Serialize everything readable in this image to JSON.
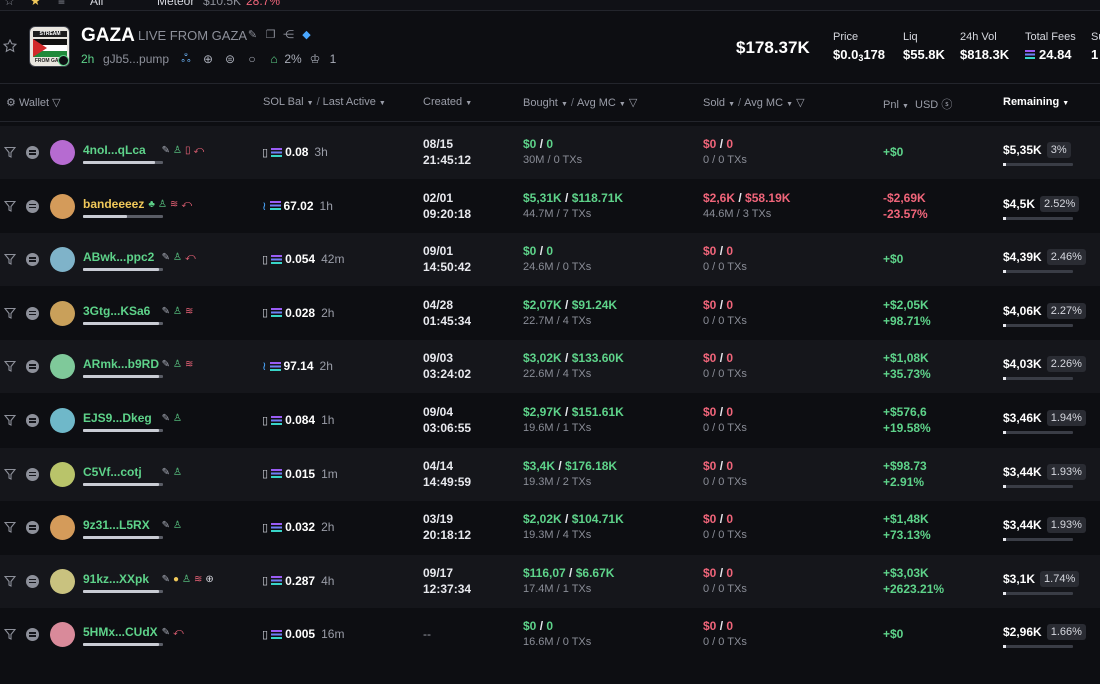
{
  "top_strip": {
    "all_label": "All",
    "ticker": "Meteor",
    "mcap": "$10.5K",
    "change": "28.7%"
  },
  "header": {
    "logo_top": "STREAM",
    "logo_bottom": "FROM GAZA",
    "ticker": "GAZA",
    "name": "LIVE FROM GAZA",
    "age": "2h",
    "address": "gJb5...pump",
    "holders_pct": "2%",
    "holders_count": "1",
    "market_cap": "$178.37K",
    "stats": [
      {
        "label": "Price",
        "value_main": "$0.0",
        "value_sub": "3",
        "value_tail": "178"
      },
      {
        "label": "Liq",
        "value": "$55.8K"
      },
      {
        "label": "24h Vol",
        "value": "$818.3K"
      },
      {
        "label": "Total Fees",
        "value": "24.84"
      },
      {
        "label": "Su",
        "value": "1"
      }
    ]
  },
  "columns": {
    "wallet": "Wallet",
    "sol_bal": "SOL Bal",
    "last_active": "Last Active",
    "created": "Created",
    "bought": "Bought",
    "avg_mc": "Avg MC",
    "sold": "Sold",
    "pnl": "Pnl",
    "usd": "USD",
    "remaining": "Remaining"
  },
  "colors": {
    "green": "#5ed38a",
    "red": "#f0657a",
    "bg": "#0d0e12",
    "row_alt": "#15161b"
  },
  "rows": [
    {
      "wallet": "4noI...qLca",
      "wallet_color": "green",
      "icons": [
        "edit-icon",
        "person-icon",
        "clipboard-icon",
        "exit-icon"
      ],
      "avatar_color": "#b66bd1",
      "invested_frac": 0.9,
      "dolphin": false,
      "sol_bal": "0.08",
      "last_active": "3h",
      "created_date": "08/15",
      "created_time": "21:45:12",
      "bought_usd": "$0",
      "bought_mc": "0",
      "bought_sub": "30M / 0 TXs",
      "sold_usd": "$0",
      "sold_mc": "0",
      "sold_sub": "0 / 0 TXs",
      "pnl1": "+$0",
      "pnl2": "",
      "pnl_color": "green",
      "remaining": "$5,35K",
      "remaining_pct": "3%"
    },
    {
      "wallet": "bandeeeez",
      "wallet_color": "yellow",
      "icons": [
        "tree-icon",
        "person-icon",
        "layers-icon",
        "exit-icon"
      ],
      "avatar_color": "#d49b5a",
      "invested_frac": 0.55,
      "dolphin": true,
      "sol_bal": "67.02",
      "last_active": "1h",
      "created_date": "02/01",
      "created_time": "09:20:18",
      "bought_usd": "$5,31K",
      "bought_mc": "$118.71K",
      "bought_sub": "44.7M / 7 TXs",
      "sold_usd": "$2,6K",
      "sold_mc": "$58.19K",
      "sold_sub": "44.6M / 3 TXs",
      "sold_red": true,
      "pnl1": "-$2,69K",
      "pnl2": "-23.57%",
      "pnl_color": "red",
      "remaining": "$4,5K",
      "remaining_pct": "2.52%"
    },
    {
      "wallet": "ABwk...ppc2",
      "wallet_color": "green",
      "icons": [
        "edit-icon",
        "person-icon",
        "exit-icon"
      ],
      "avatar_color": "#7fb3c9",
      "invested_frac": 0.95,
      "dolphin": false,
      "sol_bal": "0.054",
      "last_active": "42m",
      "created_date": "09/01",
      "created_time": "14:50:42",
      "bought_usd": "$0",
      "bought_mc": "0",
      "bought_sub": "24.6M / 0 TXs",
      "sold_usd": "$0",
      "sold_mc": "0",
      "sold_sub": "0 / 0 TXs",
      "pnl1": "+$0",
      "pnl2": "",
      "pnl_color": "green",
      "remaining": "$4,39K",
      "remaining_pct": "2.46%"
    },
    {
      "wallet": "3Gtg...KSa6",
      "wallet_color": "green",
      "icons": [
        "edit-icon",
        "person-icon",
        "layers-icon"
      ],
      "avatar_color": "#c9a05a",
      "invested_frac": 0.95,
      "dolphin": false,
      "sol_bal": "0.028",
      "last_active": "2h",
      "created_date": "04/28",
      "created_time": "01:45:34",
      "bought_usd": "$2,07K",
      "bought_mc": "$91.24K",
      "bought_sub": "22.7M / 4 TXs",
      "sold_usd": "$0",
      "sold_mc": "0",
      "sold_sub": "0 / 0 TXs",
      "pnl1": "+$2,05K",
      "pnl2": "+98.71%",
      "pnl_color": "green",
      "remaining": "$4,06K",
      "remaining_pct": "2.27%"
    },
    {
      "wallet": "ARmk...b9RD",
      "wallet_color": "green",
      "icons": [
        "edit-icon",
        "person-icon",
        "layers-icon"
      ],
      "avatar_color": "#7fc99a",
      "invested_frac": 0.95,
      "dolphin": true,
      "sol_bal": "97.14",
      "last_active": "2h",
      "created_date": "09/03",
      "created_time": "03:24:02",
      "bought_usd": "$3,02K",
      "bought_mc": "$133.60K",
      "bought_sub": "22.6M / 4 TXs",
      "sold_usd": "$0",
      "sold_mc": "0",
      "sold_sub": "0 / 0 TXs",
      "pnl1": "+$1,08K",
      "pnl2": "+35.73%",
      "pnl_color": "green",
      "remaining": "$4,03K",
      "remaining_pct": "2.26%"
    },
    {
      "wallet": "EJS9...Dkeg",
      "wallet_color": "green",
      "icons": [
        "edit-icon",
        "person-icon"
      ],
      "avatar_color": "#6fb8c9",
      "invested_frac": 0.95,
      "dolphin": false,
      "sol_bal": "0.084",
      "last_active": "1h",
      "created_date": "09/04",
      "created_time": "03:06:55",
      "bought_usd": "$2,97K",
      "bought_mc": "$151.61K",
      "bought_sub": "19.6M / 1 TXs",
      "sold_usd": "$0",
      "sold_mc": "0",
      "sold_sub": "0 / 0 TXs",
      "pnl1": "+$576,6",
      "pnl2": "+19.58%",
      "pnl_color": "green",
      "remaining": "$3,46K",
      "remaining_pct": "1.94%"
    },
    {
      "wallet": "C5Vf...cotj",
      "wallet_color": "green",
      "icons": [
        "edit-icon",
        "person-icon"
      ],
      "avatar_color": "#b9c46a",
      "invested_frac": 0.95,
      "dolphin": false,
      "sol_bal": "0.015",
      "last_active": "1m",
      "created_date": "04/14",
      "created_time": "14:49:59",
      "bought_usd": "$3,4K",
      "bought_mc": "$176.18K",
      "bought_sub": "19.3M / 2 TXs",
      "sold_usd": "$0",
      "sold_mc": "0",
      "sold_sub": "0 / 0 TXs",
      "pnl1": "+$98.73",
      "pnl2": "+2.91%",
      "pnl_color": "green",
      "remaining": "$3,44K",
      "remaining_pct": "1.93%"
    },
    {
      "wallet": "9z31...L5RX",
      "wallet_color": "green",
      "icons": [
        "edit-icon",
        "person-icon"
      ],
      "avatar_color": "#d49b5a",
      "invested_frac": 0.95,
      "dolphin": false,
      "sol_bal": "0.032",
      "last_active": "2h",
      "created_date": "03/19",
      "created_time": "20:18:12",
      "bought_usd": "$2,02K",
      "bought_mc": "$104.71K",
      "bought_sub": "19.3M / 4 TXs",
      "sold_usd": "$0",
      "sold_mc": "0",
      "sold_sub": "0 / 0 TXs",
      "pnl1": "+$1,48K",
      "pnl2": "+73.13%",
      "pnl_color": "green",
      "remaining": "$3,44K",
      "remaining_pct": "1.93%"
    },
    {
      "wallet": "91kz...XXpk",
      "wallet_color": "green",
      "icons": [
        "edit-icon",
        "crown-icon",
        "person-icon",
        "layers-icon",
        "target-icon"
      ],
      "avatar_color": "#c9c27f",
      "invested_frac": 0.95,
      "dolphin": false,
      "sol_bal": "0.287",
      "last_active": "4h",
      "created_date": "09/17",
      "created_time": "12:37:34",
      "bought_usd": "$116,07",
      "bought_mc": "$6.67K",
      "bought_sub": "17.4M / 1 TXs",
      "sold_usd": "$0",
      "sold_mc": "0",
      "sold_sub": "0 / 0 TXs",
      "pnl1": "+$3,03K",
      "pnl2": "+2623.21%",
      "pnl_color": "green",
      "remaining": "$3,1K",
      "remaining_pct": "1.74%"
    },
    {
      "wallet": "5HMx...CUdX",
      "wallet_color": "green",
      "icons": [
        "edit-icon",
        "exit-icon"
      ],
      "avatar_color": "#d98a9a",
      "invested_frac": 0.95,
      "dolphin": false,
      "sol_bal": "0.005",
      "last_active": "16m",
      "created_date": "--",
      "created_time": "",
      "bought_usd": "$0",
      "bought_mc": "0",
      "bought_sub": "16.6M / 0 TXs",
      "sold_usd": "$0",
      "sold_mc": "0",
      "sold_sub": "0 / 0 TXs",
      "pnl1": "+$0",
      "pnl2": "",
      "pnl_color": "green",
      "remaining": "$2,96K",
      "remaining_pct": "1.66%"
    }
  ]
}
